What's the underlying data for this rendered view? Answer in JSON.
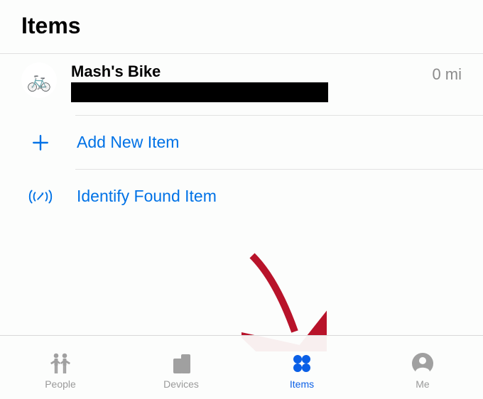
{
  "header": {
    "title": "Items"
  },
  "item": {
    "icon_name": "bicycle-icon",
    "name": "Mash's Bike",
    "distance": "0 mi"
  },
  "actions": {
    "add": {
      "label": "Add New Item"
    },
    "identify": {
      "label": "Identify Found Item"
    }
  },
  "tabbar": {
    "people": {
      "label": "People"
    },
    "devices": {
      "label": "Devices"
    },
    "items": {
      "label": "Items"
    },
    "me": {
      "label": "Me"
    },
    "active": "items"
  },
  "colors": {
    "accent": "#0a5fe6",
    "gray_icon": "#a0a0a0"
  }
}
